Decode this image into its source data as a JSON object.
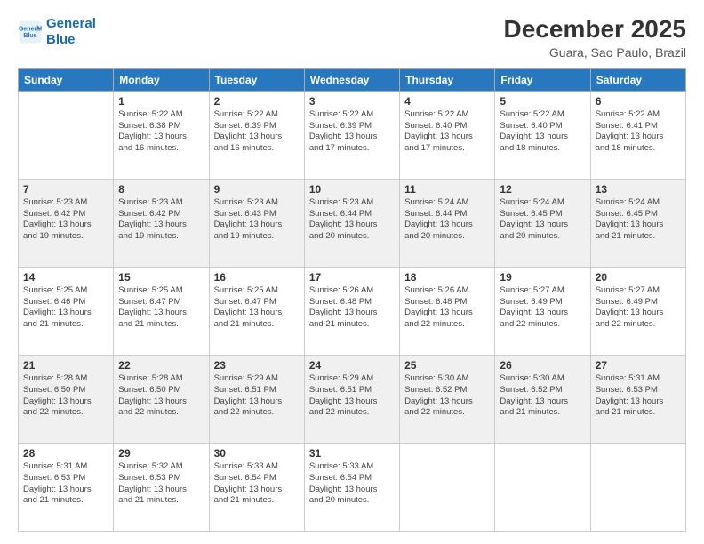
{
  "logo": {
    "line1": "General",
    "line2": "Blue"
  },
  "title": "December 2025",
  "subtitle": "Guara, Sao Paulo, Brazil",
  "weekdays": [
    "Sunday",
    "Monday",
    "Tuesday",
    "Wednesday",
    "Thursday",
    "Friday",
    "Saturday"
  ],
  "weeks": [
    [
      {
        "day": "",
        "info": ""
      },
      {
        "day": "1",
        "info": "Sunrise: 5:22 AM\nSunset: 6:38 PM\nDaylight: 13 hours\nand 16 minutes."
      },
      {
        "day": "2",
        "info": "Sunrise: 5:22 AM\nSunset: 6:39 PM\nDaylight: 13 hours\nand 16 minutes."
      },
      {
        "day": "3",
        "info": "Sunrise: 5:22 AM\nSunset: 6:39 PM\nDaylight: 13 hours\nand 17 minutes."
      },
      {
        "day": "4",
        "info": "Sunrise: 5:22 AM\nSunset: 6:40 PM\nDaylight: 13 hours\nand 17 minutes."
      },
      {
        "day": "5",
        "info": "Sunrise: 5:22 AM\nSunset: 6:40 PM\nDaylight: 13 hours\nand 18 minutes."
      },
      {
        "day": "6",
        "info": "Sunrise: 5:22 AM\nSunset: 6:41 PM\nDaylight: 13 hours\nand 18 minutes."
      }
    ],
    [
      {
        "day": "7",
        "info": "Sunrise: 5:23 AM\nSunset: 6:42 PM\nDaylight: 13 hours\nand 19 minutes."
      },
      {
        "day": "8",
        "info": "Sunrise: 5:23 AM\nSunset: 6:42 PM\nDaylight: 13 hours\nand 19 minutes."
      },
      {
        "day": "9",
        "info": "Sunrise: 5:23 AM\nSunset: 6:43 PM\nDaylight: 13 hours\nand 19 minutes."
      },
      {
        "day": "10",
        "info": "Sunrise: 5:23 AM\nSunset: 6:44 PM\nDaylight: 13 hours\nand 20 minutes."
      },
      {
        "day": "11",
        "info": "Sunrise: 5:24 AM\nSunset: 6:44 PM\nDaylight: 13 hours\nand 20 minutes."
      },
      {
        "day": "12",
        "info": "Sunrise: 5:24 AM\nSunset: 6:45 PM\nDaylight: 13 hours\nand 20 minutes."
      },
      {
        "day": "13",
        "info": "Sunrise: 5:24 AM\nSunset: 6:45 PM\nDaylight: 13 hours\nand 21 minutes."
      }
    ],
    [
      {
        "day": "14",
        "info": "Sunrise: 5:25 AM\nSunset: 6:46 PM\nDaylight: 13 hours\nand 21 minutes."
      },
      {
        "day": "15",
        "info": "Sunrise: 5:25 AM\nSunset: 6:47 PM\nDaylight: 13 hours\nand 21 minutes."
      },
      {
        "day": "16",
        "info": "Sunrise: 5:25 AM\nSunset: 6:47 PM\nDaylight: 13 hours\nand 21 minutes."
      },
      {
        "day": "17",
        "info": "Sunrise: 5:26 AM\nSunset: 6:48 PM\nDaylight: 13 hours\nand 21 minutes."
      },
      {
        "day": "18",
        "info": "Sunrise: 5:26 AM\nSunset: 6:48 PM\nDaylight: 13 hours\nand 22 minutes."
      },
      {
        "day": "19",
        "info": "Sunrise: 5:27 AM\nSunset: 6:49 PM\nDaylight: 13 hours\nand 22 minutes."
      },
      {
        "day": "20",
        "info": "Sunrise: 5:27 AM\nSunset: 6:49 PM\nDaylight: 13 hours\nand 22 minutes."
      }
    ],
    [
      {
        "day": "21",
        "info": "Sunrise: 5:28 AM\nSunset: 6:50 PM\nDaylight: 13 hours\nand 22 minutes."
      },
      {
        "day": "22",
        "info": "Sunrise: 5:28 AM\nSunset: 6:50 PM\nDaylight: 13 hours\nand 22 minutes."
      },
      {
        "day": "23",
        "info": "Sunrise: 5:29 AM\nSunset: 6:51 PM\nDaylight: 13 hours\nand 22 minutes."
      },
      {
        "day": "24",
        "info": "Sunrise: 5:29 AM\nSunset: 6:51 PM\nDaylight: 13 hours\nand 22 minutes."
      },
      {
        "day": "25",
        "info": "Sunrise: 5:30 AM\nSunset: 6:52 PM\nDaylight: 13 hours\nand 22 minutes."
      },
      {
        "day": "26",
        "info": "Sunrise: 5:30 AM\nSunset: 6:52 PM\nDaylight: 13 hours\nand 21 minutes."
      },
      {
        "day": "27",
        "info": "Sunrise: 5:31 AM\nSunset: 6:53 PM\nDaylight: 13 hours\nand 21 minutes."
      }
    ],
    [
      {
        "day": "28",
        "info": "Sunrise: 5:31 AM\nSunset: 6:53 PM\nDaylight: 13 hours\nand 21 minutes."
      },
      {
        "day": "29",
        "info": "Sunrise: 5:32 AM\nSunset: 6:53 PM\nDaylight: 13 hours\nand 21 minutes."
      },
      {
        "day": "30",
        "info": "Sunrise: 5:33 AM\nSunset: 6:54 PM\nDaylight: 13 hours\nand 21 minutes."
      },
      {
        "day": "31",
        "info": "Sunrise: 5:33 AM\nSunset: 6:54 PM\nDaylight: 13 hours\nand 20 minutes."
      },
      {
        "day": "",
        "info": ""
      },
      {
        "day": "",
        "info": ""
      },
      {
        "day": "",
        "info": ""
      }
    ]
  ]
}
